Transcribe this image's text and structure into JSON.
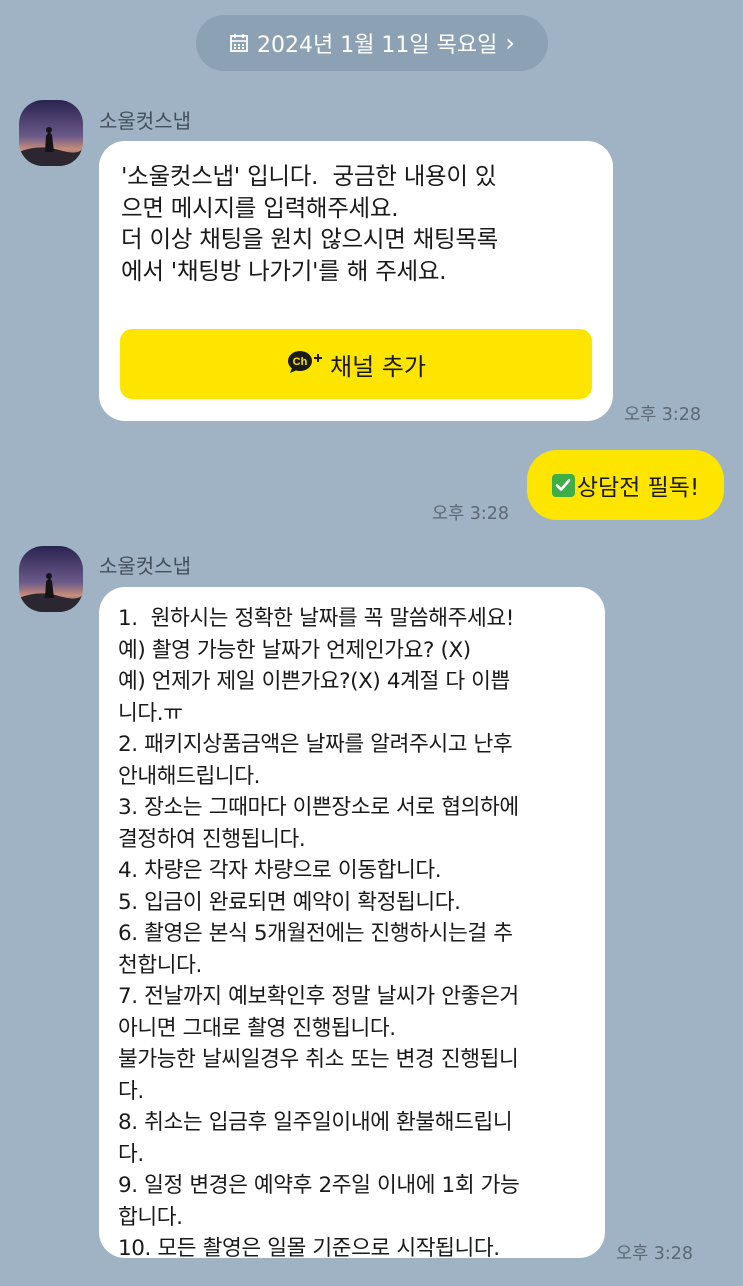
{
  "date_header": {
    "label": "2024년 1월 11일 목요일",
    "arrow": "›",
    "icon": "calendar-icon"
  },
  "messages": [
    {
      "sender": "소울컷스냅",
      "text": "'소울컷스냅' 입니다.  궁금한 내용이 있\n으면 메시지를 입력해주세요.\n더 이상 채팅을 원치 않으시면 채팅목록\n에서 '채팅방 나가기'를 해 주세요.",
      "button_label": "채널 추가",
      "button_icon": "ch-plus-icon",
      "time": "오후 3:28"
    },
    {
      "text": "상담전 필독!",
      "icon": "check-mark-icon",
      "time": "오후 3:28"
    },
    {
      "sender": "소울컷스냅",
      "text": "1.  원하시는 정확한 날짜를 꼭 말씀해주세요!\n예) 촬영 가능한 날짜가 언제인가요? (X)\n예) 언제가 제일 이쁜가요?(X) 4계절 다 이쁩\n니다.ㅠ\n2. 패키지상품금액은 날짜를 알려주시고 난후\n안내해드립니다.\n3. 장소는 그때마다 이쁜장소로 서로 협의하에\n결정하여 진행됩니다.\n4. 차량은 각자 차량으로 이동합니다.\n5. 입금이 완료되면 예약이 확정됩니다.\n6. 촬영은 본식 5개월전에는 진행하시는걸 추\n천합니다.\n7. 전날까지 예보확인후 정말 날씨가 안좋은거\n아니면 그대로 촬영 진행됩니다.\n불가능한 날씨일경우 취소 또는 변경 진행됩니\n다.\n8. 취소는 입금후 일주일이내에 환불해드립니\n다.\n9. 일정 변경은 예약후 2주일 이내에 1회 가능\n합니다.\n10. 모든 촬영은 일몰 기준으로 시작됩니다.",
      "time": "오후 3:28"
    }
  ],
  "colors": {
    "background": "#9fb3c5",
    "accent": "#fee500",
    "bubble": "#ffffff"
  }
}
